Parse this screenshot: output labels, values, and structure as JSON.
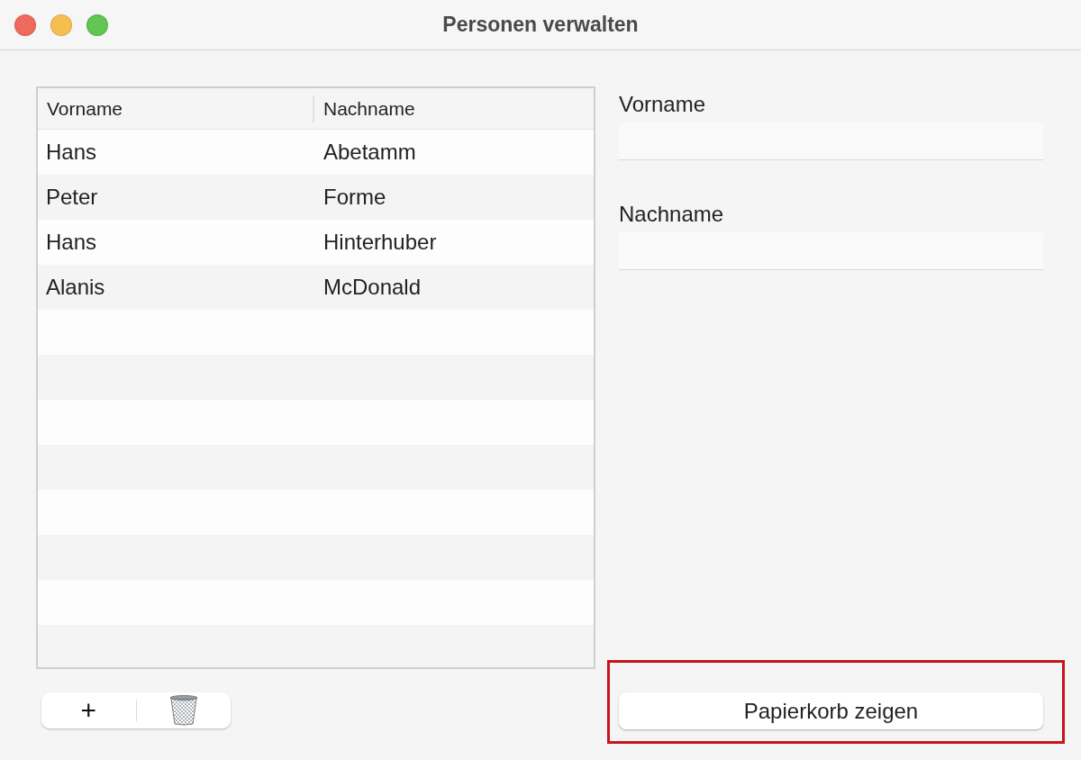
{
  "window": {
    "title": "Personen verwalten"
  },
  "table": {
    "columns": [
      "Vorname",
      "Nachname"
    ],
    "rows": [
      {
        "cells": [
          "Hans",
          "Abetamm"
        ]
      },
      {
        "cells": [
          "Peter",
          "Forme"
        ]
      },
      {
        "cells": [
          "Hans",
          "Hinterhuber"
        ]
      },
      {
        "cells": [
          "Alanis",
          "McDonald"
        ]
      }
    ]
  },
  "form": {
    "fields": [
      {
        "label": "Vorname"
      },
      {
        "label": "Nachname"
      }
    ]
  },
  "toolbar": {
    "add": "+"
  },
  "button": {
    "label": "Papierkorb zeigen"
  }
}
